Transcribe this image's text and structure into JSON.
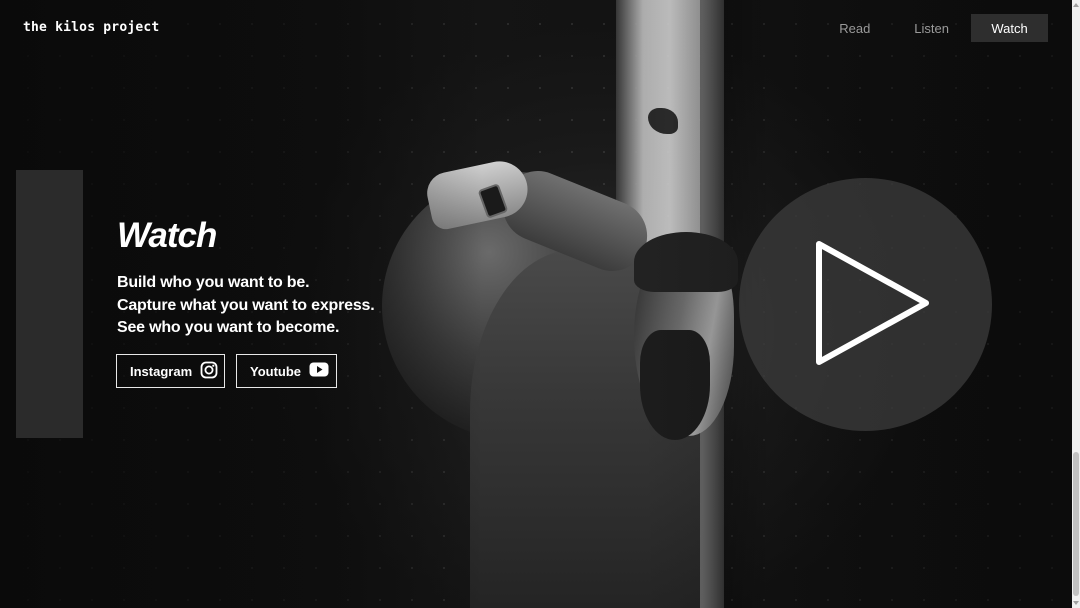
{
  "header": {
    "logo": "the kilos project",
    "nav": [
      {
        "label": "Read",
        "active": false
      },
      {
        "label": "Listen",
        "active": false
      },
      {
        "label": "Watch",
        "active": true
      }
    ]
  },
  "main": {
    "title": "Watch",
    "tagline": [
      "Build who you want to be.",
      "Capture what you want to express.",
      "See who you want to become."
    ],
    "social": {
      "instagram": {
        "label": "Instagram",
        "icon": "instagram-icon"
      },
      "youtube": {
        "label": "Youtube",
        "icon": "youtube-icon"
      }
    },
    "play_icon": "play-icon"
  },
  "colors": {
    "background": "#0c0c0c",
    "text": "#ffffff",
    "nav_inactive": "#9a9a9a",
    "nav_active_bg": "#2e2e2e",
    "accent_bar": "#2b2b2b"
  }
}
